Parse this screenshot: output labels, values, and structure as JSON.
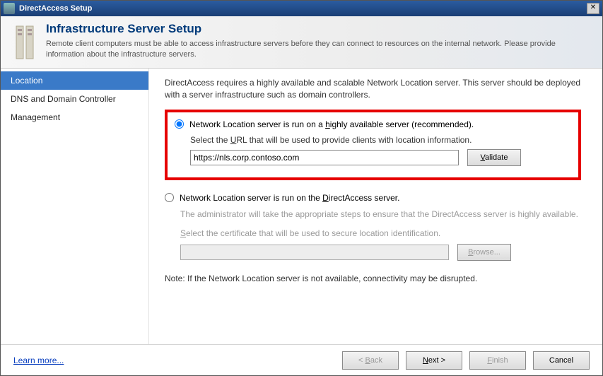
{
  "titlebar": {
    "title": "DirectAccess Setup"
  },
  "header": {
    "title": "Infrastructure Server Setup",
    "description": "Remote client computers must be able to access infrastructure servers before they can connect to resources on the internal network. Please provide information about the infrastructure servers."
  },
  "sidebar": {
    "items": [
      {
        "label": "Location",
        "active": true
      },
      {
        "label": "DNS and Domain Controller",
        "active": false
      },
      {
        "label": "Management",
        "active": false
      }
    ]
  },
  "main": {
    "intro": "DirectAccess requires a highly available and scalable Network Location server. This server should be deployed with a server infrastructure such as domain controllers.",
    "option1": {
      "prefix": "Network Location server is run on a ",
      "underlined": "h",
      "rest": "ighly available server (recommended).",
      "sublabel_prefix": "Select the ",
      "sublabel_underlined": "U",
      "sublabel_rest": "RL that will be used to provide clients with location information.",
      "url_value": "https://nls.corp.contoso.com",
      "validate_u": "V",
      "validate_rest": "alidate"
    },
    "option2": {
      "prefix": "Network Location server is run on the ",
      "underlined": "D",
      "rest": "irectAccess server.",
      "desc": "The administrator will take the appropriate steps to ensure that the DirectAccess server is highly available.",
      "certlabel_u": "S",
      "certlabel_rest": "elect the certificate that will be used to secure location identification.",
      "browse_u": "B",
      "browse_rest": "rowse..."
    },
    "note": "Note: If the Network Location server is not available, connectivity may be disrupted."
  },
  "footer": {
    "learn": "Learn more...",
    "back_lt": "< ",
    "back_u": "B",
    "back_rest": "ack",
    "next_u": "N",
    "next_rest": "ext >",
    "finish_u": "F",
    "finish_rest": "inish",
    "cancel": "Cancel"
  }
}
